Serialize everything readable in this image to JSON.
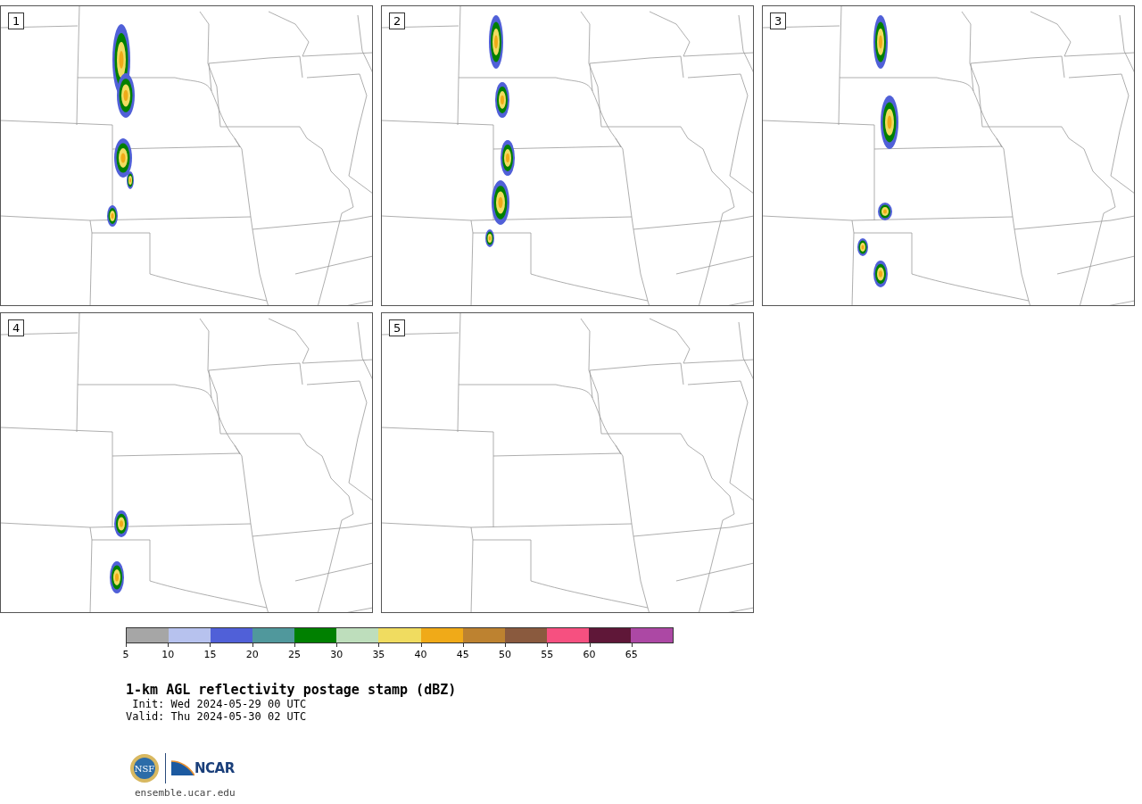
{
  "panels": [
    {
      "label": "1"
    },
    {
      "label": "2"
    },
    {
      "label": "3"
    },
    {
      "label": "4"
    },
    {
      "label": "5"
    }
  ],
  "colorbar": {
    "segments": [
      {
        "color": "#a6a6a6"
      },
      {
        "color": "#b7c2ee"
      },
      {
        "color": "#5060d8"
      },
      {
        "color": "#50989c"
      },
      {
        "color": "#008000"
      },
      {
        "color": "#bedebc"
      },
      {
        "color": "#f0dc60"
      },
      {
        "color": "#f0aa18"
      },
      {
        "color": "#bd8230"
      },
      {
        "color": "#8a5a3e"
      },
      {
        "color": "#f65080"
      },
      {
        "color": "#5f1738"
      },
      {
        "color": "#ac48a4"
      }
    ],
    "ticks": [
      "5",
      "10",
      "15",
      "20",
      "25",
      "30",
      "35",
      "40",
      "45",
      "50",
      "55",
      "60",
      "65"
    ]
  },
  "title": "1-km AGL reflectivity postage stamp (dBZ)",
  "init": " Init: Wed 2024-05-29 00 UTC",
  "valid": "Valid: Thu 2024-05-30 02 UTC",
  "logo": {
    "seal_text": "NSF",
    "wordmark": "NCAR"
  },
  "website": "ensemble.ucar.edu"
}
